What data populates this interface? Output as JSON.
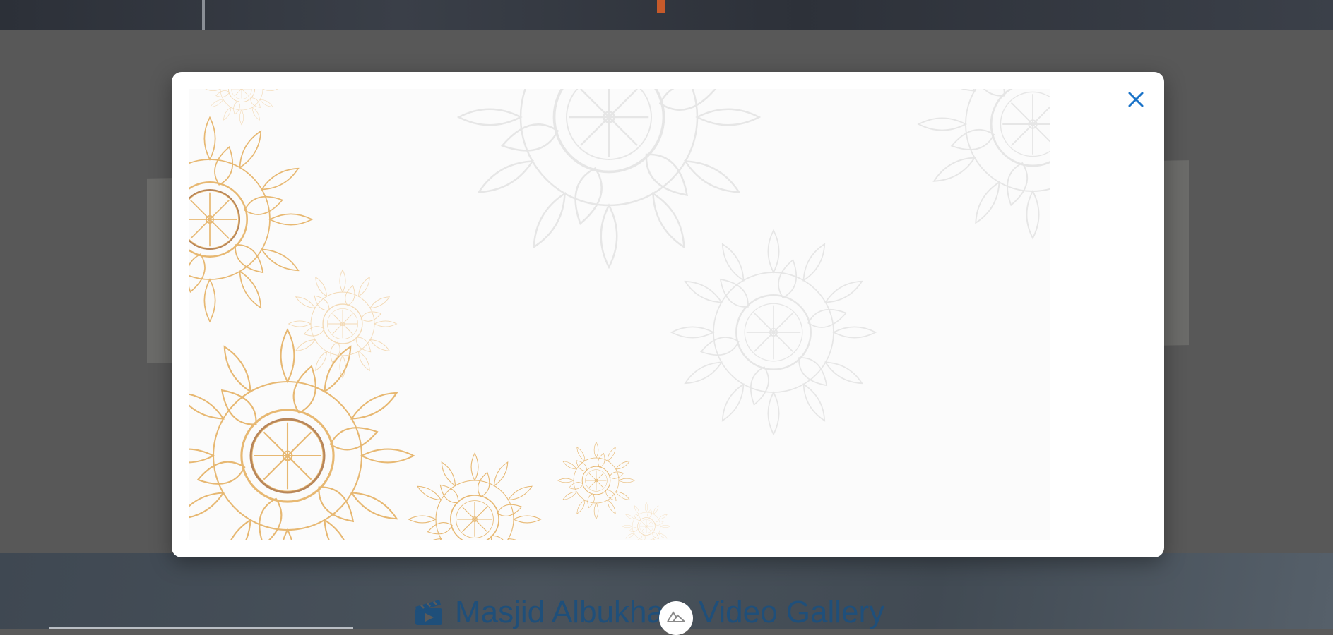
{
  "page": {
    "gallery_title": "Masjid Albukhary Video Gallery"
  },
  "icons": {
    "gallery": "film-clapper-icon",
    "close": "close-icon",
    "badge": "nuxt-logo-icon"
  },
  "colors": {
    "accent_blue": "#1a73c8",
    "title_blue": "#1f4f7a",
    "overlay": "#5a5a5a",
    "mandala_gold": "#e7b872",
    "mandala_brown": "#b8865a",
    "mandala_grey": "#e6e6e6"
  }
}
